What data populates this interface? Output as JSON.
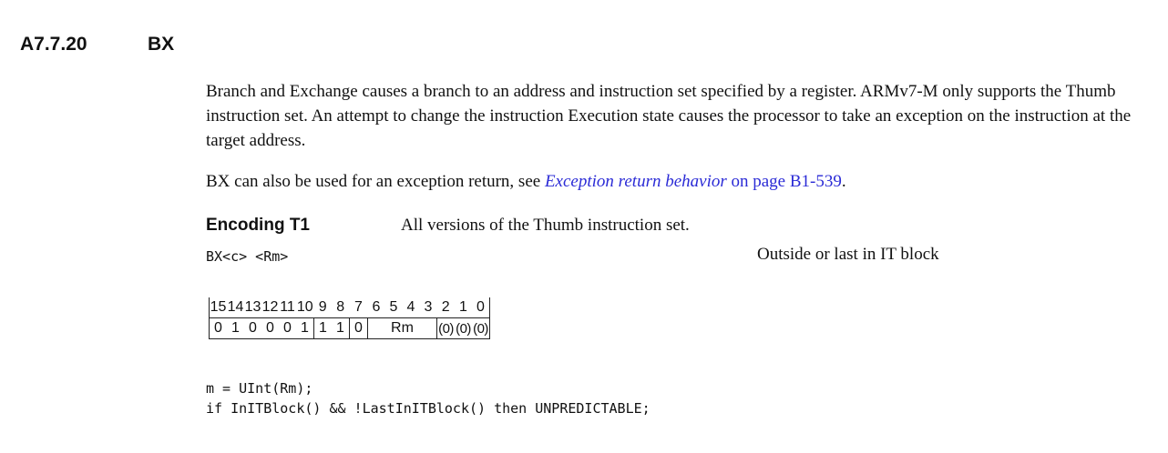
{
  "section": {
    "number": "A7.7.20",
    "title": "BX"
  },
  "description": {
    "p1": "Branch and Exchange causes a branch to an address and instruction set specified by a register. ARMv7-M only supports the Thumb instruction set. An attempt to change the instruction Execution state causes the processor to take an exception on the instruction at the target address.",
    "p2_prefix": "BX can also be used for an exception return, see ",
    "p2_link": "Exception return behavior",
    "p2_link_page": " on page B1-539",
    "p2_suffix": "."
  },
  "encoding": {
    "label": "Encoding T1",
    "description": "All versions of the Thumb instruction set.",
    "syntax": "BX<c> <Rm>",
    "it_note": "Outside or last in IT block",
    "bit_numbers": [
      "15",
      "14",
      "13",
      "12",
      "11",
      "10",
      "9",
      "8",
      "7",
      "6",
      "5",
      "4",
      "3",
      "2",
      "1",
      "0"
    ],
    "fields": {
      "b15": "0",
      "b14": "1",
      "b13": "0",
      "b12": "0",
      "b11": "0",
      "b10": "1",
      "b9": "1",
      "b8": "1",
      "b7": "0",
      "rm": "Rm",
      "b2": "(0)",
      "b1": "(0)",
      "b0": "(0)"
    }
  },
  "pseudocode": {
    "line1": "m = UInt(Rm);",
    "line2": "if InITBlock() && !LastInITBlock() then UNPREDICTABLE;"
  }
}
